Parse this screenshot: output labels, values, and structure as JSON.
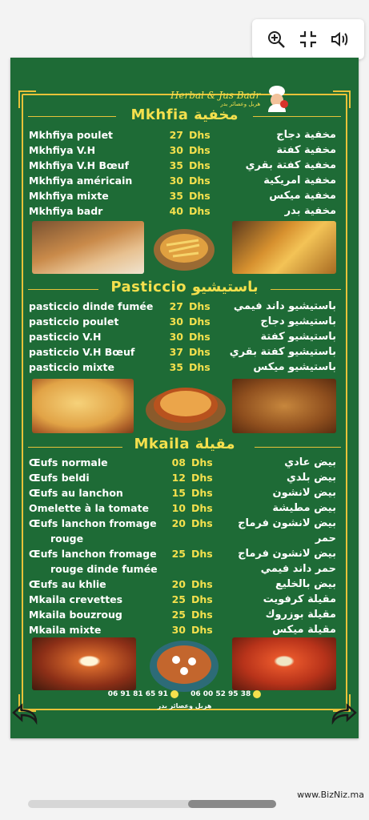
{
  "toolbar": {
    "icons": [
      "zoom-in-icon",
      "fullscreen-exit-icon",
      "volume-icon"
    ]
  },
  "logo": {
    "main": "Herbal & Jus Badr",
    "sub": "هربل وعصائر بدر"
  },
  "sections": {
    "mkhfia": {
      "title": "Mkhfia  مخفية",
      "items": [
        {
          "fr": "Mkhfiya poulet",
          "price": "27",
          "cur": "Dhs",
          "ar": "مخفية دجاج"
        },
        {
          "fr": "Mkhfiya V.H",
          "price": "30",
          "cur": "Dhs",
          "ar": "مخفية كفتة"
        },
        {
          "fr": "Mkhfiya V.H Bœuf",
          "price": "35",
          "cur": "Dhs",
          "ar": "مخفية كفتة بقري"
        },
        {
          "fr": "Mkhfiya américain",
          "price": "30",
          "cur": "Dhs",
          "ar": "مخفية امريكية"
        },
        {
          "fr": "Mkhfiya mixte",
          "price": "35",
          "cur": "Dhs",
          "ar": "مخفية ميكس"
        },
        {
          "fr": "Mkhfiya badr",
          "price": "40",
          "cur": "Dhs",
          "ar": "مخفية بدر"
        }
      ]
    },
    "pasticcio": {
      "title": "Pasticcio  باستيشيو",
      "items": [
        {
          "fr": "pasticcio dinde fumée",
          "price": "27",
          "cur": "Dhs",
          "ar": "باستيشيو داند فيمي"
        },
        {
          "fr": "pasticcio poulet",
          "price": "30",
          "cur": "Dhs",
          "ar": "باستيشيو دجاج"
        },
        {
          "fr": "pasticcio V.H",
          "price": "30",
          "cur": "Dhs",
          "ar": "باستيشيو كفتة"
        },
        {
          "fr": "pasticcio V.H Bœuf",
          "price": "37",
          "cur": "Dhs",
          "ar": "باستيشيو كفتة بقري"
        },
        {
          "fr": "pasticcio mixte",
          "price": "35",
          "cur": "Dhs",
          "ar": "باستيشيو ميكس"
        }
      ]
    },
    "mkaila": {
      "title": "Mkaila  مقيلة",
      "items": [
        {
          "fr": "Œufs normale",
          "price": "08",
          "cur": "Dhs",
          "ar": "بيض عادي"
        },
        {
          "fr": "Œufs beldi",
          "price": "12",
          "cur": "Dhs",
          "ar": "بيض بلدي"
        },
        {
          "fr": "Œufs au lanchon",
          "price": "15",
          "cur": "Dhs",
          "ar": "بيض لانشون"
        },
        {
          "fr": "Omelette à la tomate",
          "price": "10",
          "cur": "Dhs",
          "ar": "بيض مطيشة"
        },
        {
          "fr": "Œufs lanchon fromage",
          "fr2": "rouge",
          "price": "20",
          "cur": "Dhs",
          "ar": "بيض لانشون فرماج",
          "ar2": "حمر"
        },
        {
          "fr": "Œufs lanchon fromage",
          "fr2": "rouge dinde fumée",
          "price": "25",
          "cur": "Dhs",
          "ar": "بيض لانشون فرماج",
          "ar2": "حمر داند فيمي"
        },
        {
          "fr": "Œufs au khlie",
          "price": "20",
          "cur": "Dhs",
          "ar": "بيض بالخليع"
        },
        {
          "fr": "Mkaila crevettes",
          "price": "25",
          "cur": "Dhs",
          "ar": "مقيلة كرفويت"
        },
        {
          "fr": "Mkaila bouzroug",
          "price": "25",
          "cur": "Dhs",
          "ar": "مقيلة بوزروك"
        },
        {
          "fr": "Mkaila mixte",
          "price": "30",
          "cur": "Dhs",
          "ar": "مقيلة ميكس"
        }
      ]
    }
  },
  "contact": {
    "phone1": "06 91 81 65 91",
    "phone2": "06 00 52 95 38",
    "shop": "هربل وعصائر بدر"
  },
  "watermark": "www.BizNiz.ma",
  "colors": {
    "green": "#1e6b36",
    "gold": "#f4e04d",
    "frame": "#e8c23a"
  }
}
